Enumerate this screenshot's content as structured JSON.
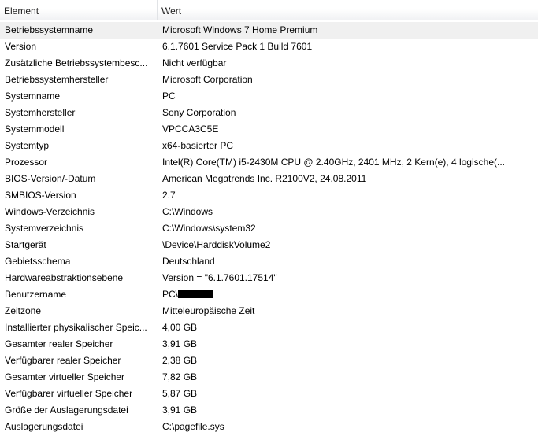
{
  "columns": {
    "element": "Element",
    "wert": "Wert"
  },
  "rows": [
    {
      "name": "Betriebssystemname",
      "value": "Microsoft Windows 7 Home Premium"
    },
    {
      "name": "Version",
      "value": "6.1.7601 Service Pack 1 Build 7601"
    },
    {
      "name": "Zusätzliche Betriebssystembesc...",
      "value": "Nicht verfügbar"
    },
    {
      "name": "Betriebssystemhersteller",
      "value": "Microsoft Corporation"
    },
    {
      "name": "Systemname",
      "value": "PC"
    },
    {
      "name": "Systemhersteller",
      "value": "Sony Corporation"
    },
    {
      "name": "Systemmodell",
      "value": "VPCCA3C5E"
    },
    {
      "name": "Systemtyp",
      "value": "x64-basierter PC"
    },
    {
      "name": "Prozessor",
      "value": "Intel(R) Core(TM) i5-2430M CPU @ 2.40GHz, 2401 MHz, 2 Kern(e), 4 logische(..."
    },
    {
      "name": "BIOS-Version/-Datum",
      "value": "American Megatrends Inc. R2100V2, 24.08.2011"
    },
    {
      "name": "SMBIOS-Version",
      "value": "2.7"
    },
    {
      "name": "Windows-Verzeichnis",
      "value": "C:\\Windows"
    },
    {
      "name": "Systemverzeichnis",
      "value": "C:\\Windows\\system32"
    },
    {
      "name": "Startgerät",
      "value": "\\Device\\HarddiskVolume2"
    },
    {
      "name": "Gebietsschema",
      "value": "Deutschland"
    },
    {
      "name": "Hardwareabstraktionsebene",
      "value": "Version = \"6.1.7601.17514\""
    },
    {
      "name": "Benutzername",
      "value": "PC\\"
    },
    {
      "name": "Zeitzone",
      "value": "Mitteleuropäische Zeit"
    },
    {
      "name": "Installierter physikalischer Speic...",
      "value": "4,00 GB"
    },
    {
      "name": "Gesamter realer Speicher",
      "value": "3,91 GB"
    },
    {
      "name": "Verfügbarer realer Speicher",
      "value": "2,38 GB"
    },
    {
      "name": "Gesamter virtueller Speicher",
      "value": "7,82 GB"
    },
    {
      "name": "Verfügbarer virtueller Speicher",
      "value": "5,87 GB"
    },
    {
      "name": "Größe der Auslagerungsdatei",
      "value": "3,91 GB"
    },
    {
      "name": "Auslagerungsdatei",
      "value": "C:\\pagefile.sys"
    }
  ]
}
